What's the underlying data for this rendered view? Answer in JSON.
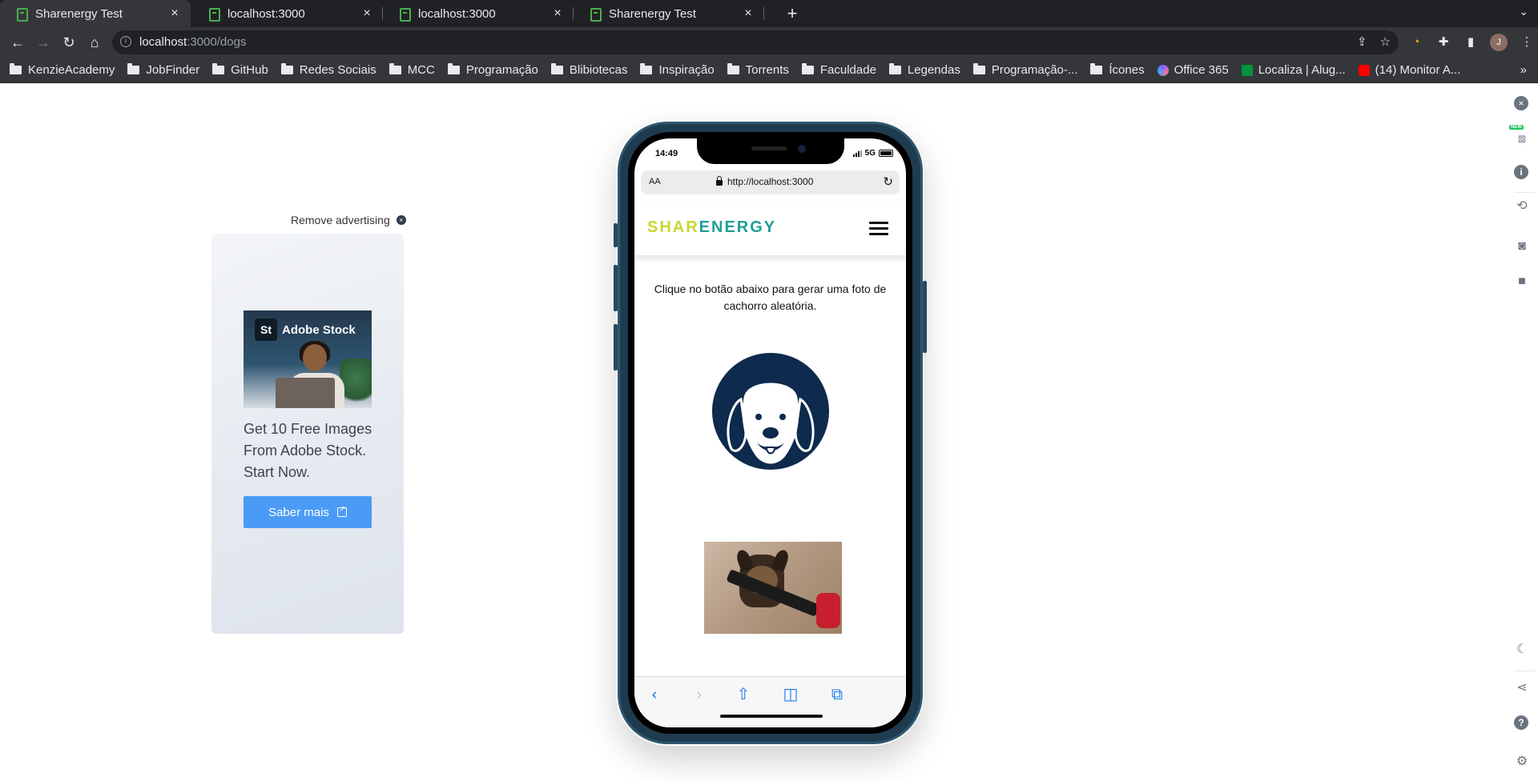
{
  "browser": {
    "tabs": [
      {
        "title": "Sharenergy Test",
        "active": true
      },
      {
        "title": "localhost:3000",
        "active": false
      },
      {
        "title": "localhost:3000",
        "active": false
      },
      {
        "title": "Sharenergy Test",
        "active": false
      }
    ],
    "close_glyph": "×",
    "new_tab_glyph": "+",
    "url_host": "localhost",
    "url_path": ":3000/dogs",
    "avatar_letter": "J",
    "bookmarks": [
      {
        "label": "KenzieAcademy",
        "type": "folder"
      },
      {
        "label": "JobFinder",
        "type": "folder"
      },
      {
        "label": "GitHub",
        "type": "folder"
      },
      {
        "label": "Redes Sociais",
        "type": "folder"
      },
      {
        "label": "MCC",
        "type": "folder"
      },
      {
        "label": "Programação",
        "type": "folder"
      },
      {
        "label": "Blibiotecas",
        "type": "folder"
      },
      {
        "label": "Inspiração",
        "type": "folder"
      },
      {
        "label": "Torrents",
        "type": "folder"
      },
      {
        "label": "Faculdade",
        "type": "folder"
      },
      {
        "label": "Legendas",
        "type": "folder"
      },
      {
        "label": "Programação-...",
        "type": "folder"
      },
      {
        "label": "Ícones",
        "type": "folder"
      },
      {
        "label": "Office 365",
        "type": "site",
        "color": "#7b61ff"
      },
      {
        "label": "Localiza | Alug...",
        "type": "site",
        "color": "#00953b"
      },
      {
        "label": "(14) Monitor A...",
        "type": "site",
        "color": "#ff0000"
      }
    ],
    "bookmarks_more": "»"
  },
  "ad": {
    "remove_label": "Remove advertising",
    "brand_badge": "St",
    "brand_name": "Adobe Stock",
    "text": "Get 10 Free Images From Adobe Stock. Start Now.",
    "button_label": "Saber mais"
  },
  "phone": {
    "status_time": "14:49",
    "network": "5G",
    "safari": {
      "aa_label": "AA",
      "url": "http://localhost:3000"
    },
    "site": {
      "logo_part1": "SHAR",
      "logo_part2": "ENERGY",
      "prompt": "Clique no botão abaixo para gerar uma foto de cachorro aleatória."
    }
  },
  "colors": {
    "logo_yellow": "#c8d82e",
    "logo_teal": "#1e9f98",
    "dog_logo_navy": "#0e2a4d",
    "ad_button": "#4a9bf5",
    "safari_blue": "#1a7cf0"
  },
  "side_panel": {
    "new_badge": "NEW",
    "icons": [
      "close-icon",
      "devices-icon",
      "info-icon",
      "rotate-icon",
      "camera-icon",
      "video-icon",
      "dark-mode-icon",
      "share-icon",
      "help-icon",
      "settings-icon"
    ]
  }
}
